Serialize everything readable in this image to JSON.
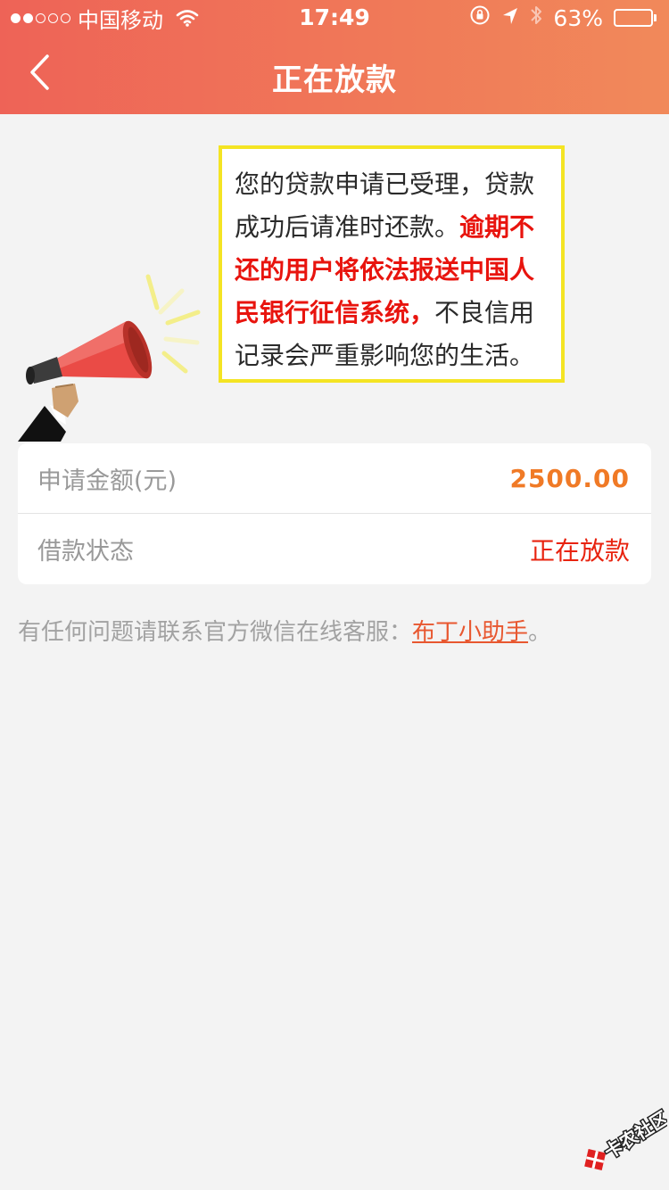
{
  "status_bar": {
    "carrier": "中国移动",
    "time": "17:49",
    "battery_percent": "63%",
    "battery_level": 0.63,
    "signal_strength": 2,
    "signal_max": 5
  },
  "nav": {
    "title": "正在放款"
  },
  "notice": {
    "text_before": "您的贷款申请已受理，贷款成功后请准时还款。",
    "text_warning": "逾期不还的用户将依法报送中国人民银行征信系统，",
    "text_after": "不良信用记录会严重影响您的生活。"
  },
  "info_card": {
    "amount_label": "申请金额(元)",
    "amount_value": "2500.00",
    "status_label": "借款状态",
    "status_value": "正在放款"
  },
  "contact": {
    "text": "有任何问题请联系官方微信在线客服：",
    "link": "布丁小助手",
    "suffix": "。"
  },
  "watermark": {
    "text": "卡农社区"
  },
  "colors": {
    "header_start": "#ee6357",
    "header_end": "#f1895a",
    "amount": "#f07a26",
    "status": "#e8230f",
    "warning": "#e8140e",
    "link": "#e8572f",
    "notice_border": "#f4e423"
  },
  "icons": {
    "back": "chevron-left-icon",
    "wifi": "wifi-icon",
    "orientation_lock": "orientation-lock-icon",
    "location": "location-arrow-icon",
    "bluetooth": "bluetooth-icon",
    "battery": "battery-icon",
    "megaphone": "megaphone-icon"
  }
}
